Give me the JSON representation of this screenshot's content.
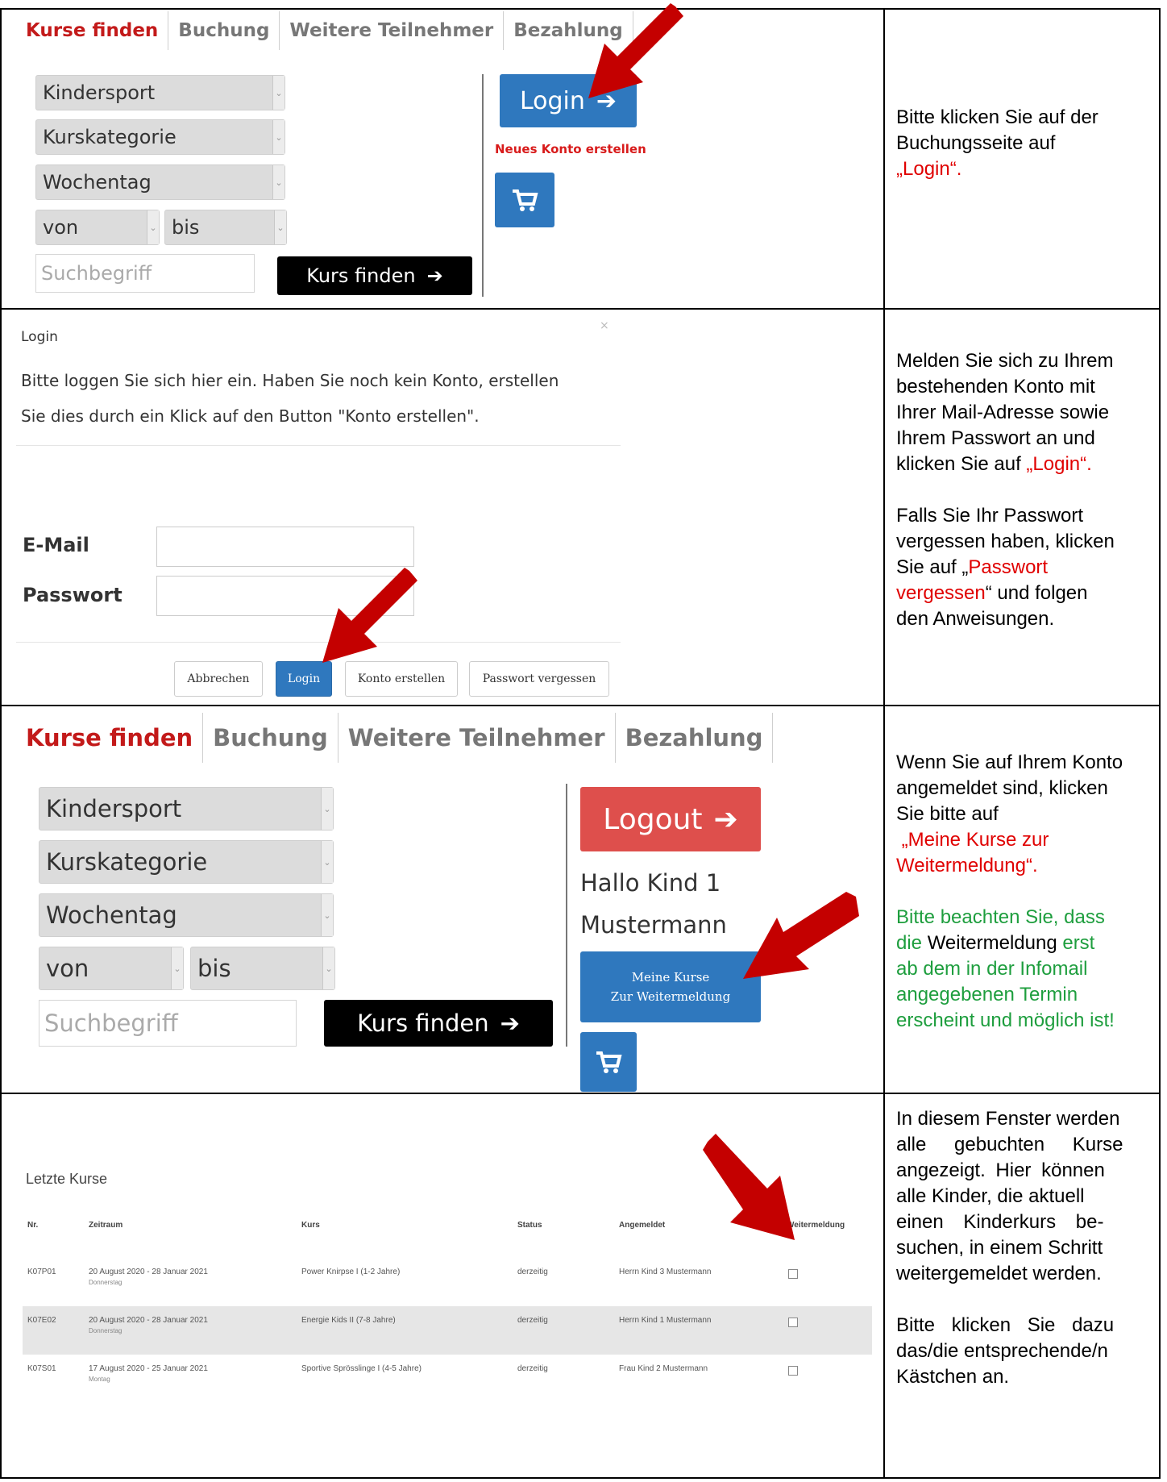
{
  "row1": {
    "tabs": [
      "Kurse finden",
      "Buchung",
      "Weitere Teilnehmer",
      "Bezahlung"
    ],
    "selects": [
      "Kindersport",
      "Kurskategorie",
      "Wochentag"
    ],
    "from_label": "von",
    "to_label": "bis",
    "search_placeholder": "Suchbegriff",
    "find_button": "Kurs finden",
    "login_button": "Login",
    "new_account_link": "Neues Konto erstellen",
    "instruction_lines": [
      "Bitte klicken Sie auf der",
      "Buchungsseite auf",
      "„Login“."
    ]
  },
  "row2": {
    "dialog_title": "Login",
    "dialog_text_1": "Bitte loggen Sie sich hier ein. Haben Sie noch kein Konto, erstellen",
    "dialog_text_2": "Sie dies durch ein Klick auf den Button \"Konto erstellen\".",
    "close_glyph": "×",
    "email_label": "E-Mail",
    "password_label": "Passwort",
    "buttons": [
      "Abbrechen",
      "Login",
      "Konto erstellen",
      "Passwort vergessen"
    ],
    "instruction_p1": [
      "Melden Sie sich zu Ihrem",
      "bestehenden Konto mit",
      "Ihrer Mail-Adresse sowie",
      "Ihrem Passwort an und"
    ],
    "instruction_p1_last_prefix": "klicken Sie auf ",
    "instruction_p1_last_red": "„Login“.",
    "instruction_p2_lines": [
      "Falls Sie Ihr Passwort",
      "vergessen haben, klicken"
    ],
    "instruction_p2_prefix": "Sie auf „",
    "instruction_p2_red_a": "Passwort",
    "instruction_p2_red_b": "vergessen",
    "instruction_p2_after": "“ und folgen",
    "instruction_p2_end": "den Anweisungen."
  },
  "row3": {
    "tabs": [
      "Kurse finden",
      "Buchung",
      "Weitere Teilnehmer",
      "Bezahlung"
    ],
    "selects": [
      "Kindersport",
      "Kurskategorie",
      "Wochentag"
    ],
    "from_label": "von",
    "to_label": "bis",
    "search_placeholder": "Suchbegriff",
    "find_button": "Kurs finden",
    "logout_button": "Logout",
    "greeting_1": "Hallo Kind 1",
    "greeting_2": "Mustermann",
    "my_courses_1": "Meine Kurse",
    "my_courses_2": "Zur Weitermeldung",
    "instruction_lines": [
      "Wenn Sie auf Ihrem Konto",
      "angemeldet sind, klicken",
      "Sie bitte auf"
    ],
    "instruction_red_1": " „Meine Kurse zur",
    "instruction_red_2": "Weitermeldung“.",
    "note_1": "Bitte beachten Sie, dass",
    "note_2_green": "die ",
    "note_2_black": "Weitermeldung",
    "note_2_green_end": " erst",
    "note_3": "ab dem in der Infomail",
    "note_4": "angegebenen Termin",
    "note_5": "erscheint und möglich ist!"
  },
  "row4": {
    "section_title": "Letzte Kurse",
    "headers": [
      "Nr.",
      "Zeitraum",
      "Kurs",
      "Status",
      "Angemeldet",
      "Weitermeldung"
    ],
    "rows": [
      {
        "nr": "K07P01",
        "period": "20 August 2020 - 28 Januar 2021",
        "day": "Donnerstag",
        "course": "Power Knirpse I (1-2 Jahre)",
        "status": "derzeitig",
        "registered": "Herrn Kind 3 Mustermann"
      },
      {
        "nr": "K07E02",
        "period": "20 August 2020 - 28 Januar 2021",
        "day": "Donnerstag",
        "course": "Energie Kids II (7-8 Jahre)",
        "status": "derzeitig",
        "registered": "Herrn Kind 1 Mustermann"
      },
      {
        "nr": "K07S01",
        "period": "17 August 2020 - 25 Januar 2021",
        "day": "Montag",
        "course": "Sportive Sprösslinge I (4-5 Jahre)",
        "status": "derzeitig",
        "registered": "Frau Kind 2 Mustermann"
      }
    ],
    "instruction_p1": [
      "In diesem Fenster werden",
      "alle gebuchten Kurse",
      "angezeigt. Hier können",
      "alle Kinder, die aktuell",
      "einen Kinderkurs be-",
      "suchen, in einem Schritt",
      "weitergemeldet werden."
    ],
    "instruction_p2": [
      "Bitte klicken Sie dazu",
      "das/die entsprechende/n",
      "Kästchen an."
    ]
  },
  "colors": {
    "accent_blue": "#2f78be",
    "tab_red": "#c31a1a",
    "logout_red": "#de4f4c",
    "arrow_red": "#c40000",
    "instruction_red": "#e00000",
    "note_green": "#1e9e3e"
  }
}
